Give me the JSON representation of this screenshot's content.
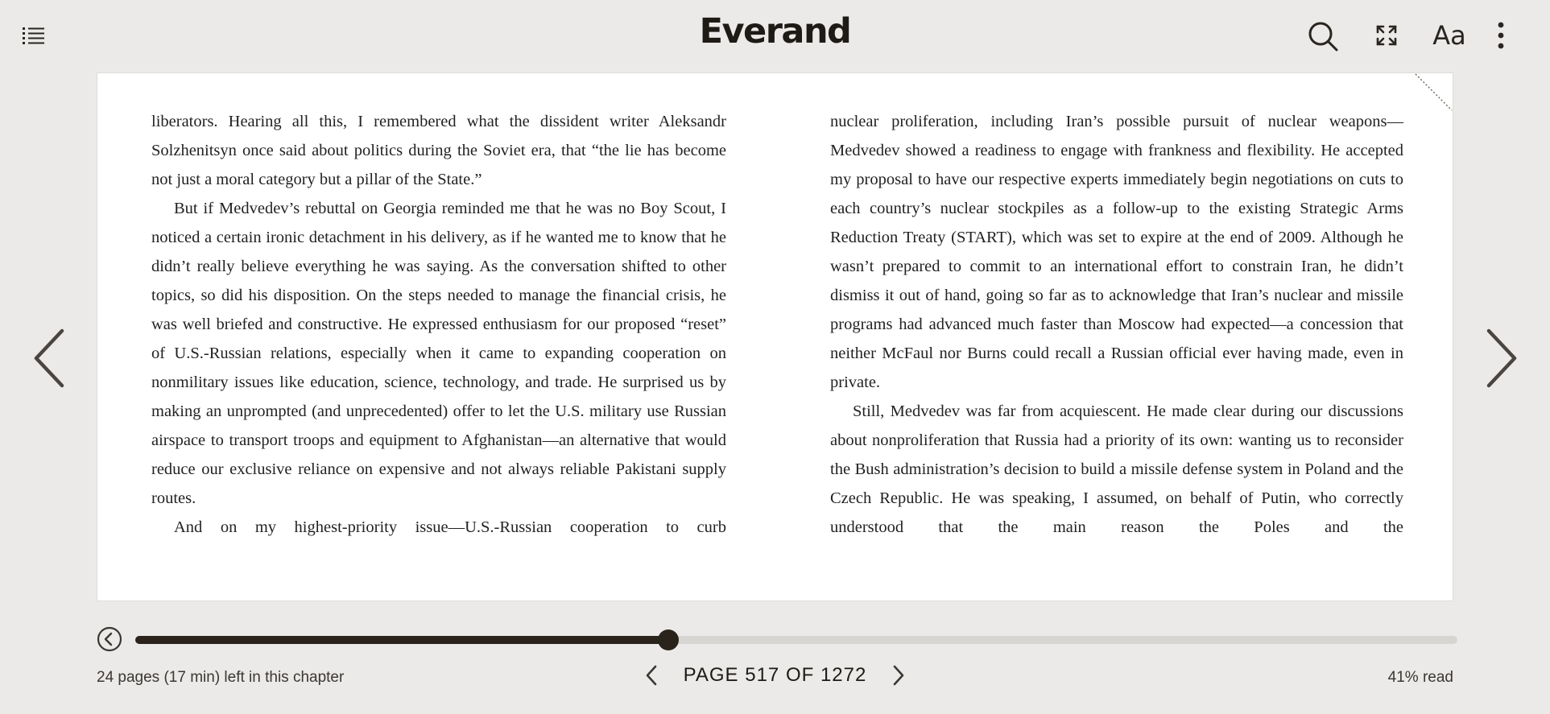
{
  "header": {
    "logo": "Everand",
    "toc_icon": "list-icon",
    "search_icon": "search-icon",
    "fullscreen_icon": "fullscreen-icon",
    "font_settings_label": "Aa",
    "more_icon": "more-vertical-icon"
  },
  "book": {
    "left_column": [
      "liberators. Hearing all this, I remembered what the dissident writer Aleksandr Solzhenitsyn once said about politics during the Soviet era, that “the lie has be­come not just a moral category but a pillar of the State.”",
      "But if Medvedev’s rebuttal on Georgia reminded me that he was no Boy Scout, I noticed a certain ironic detachment in his delivery, as if he wanted me to know that he didn’t really believe everything he was saying. As the conver­sation shifted to other topics, so did his disposition. On the steps needed to manage the financial crisis, he was well briefed and constructive. He expressed enthusiasm for our proposed “reset” of U.S.-Russian relations, especially when it came to expanding cooperation on nonmilitary issues like education, science, technology, and trade. He surprised us by making an unprompted (and un­precedented) offer to let the U.S. military use Russian airspace to transport troops and equipment to Afghanistan—an alternative that would reduce our exclusive reliance on expensive and not always reliable Pakistani supply routes.",
      "And on my highest-priority issue—U.S.-Russian cooperation to curb"
    ],
    "right_column": [
      "nuclear proliferation, including Iran’s possible pursuit of nuclear weapons—Medvedev showed a readiness to engage with frankness and flexibility. He ac­cepted my proposal to have our respective experts immediately begin negoti­ations on cuts to each country’s nuclear stockpiles as a follow-up to the exist­ing Strategic Arms Reduction Treaty (START), which was set to expire at the end of 2009. Although he wasn’t prepared to commit to an international effort to constrain Iran, he didn’t dismiss it out of hand, going so far as to acknowl­edge that Iran’s nuclear and missile programs had advanced much faster than Moscow had expected—a concession that neither McFaul nor Burns could re­call a Russian official ever having made, even in private.",
      "Still, Medvedev was far from acquiescent. He made clear during our discus­sions about nonproliferation that Russia had a priority of its own: wanting us to reconsider the Bush administration’s decision to build a missile defense sys­tem in Poland and the Czech Republic. He was speaking, I assumed, on behalf of Putin, who correctly understood that the main reason the Poles and the"
    ]
  },
  "navigation": {
    "prev_page_icon": "chevron-left-icon",
    "next_page_icon": "chevron-right-icon"
  },
  "progress": {
    "back_icon": "back-circle-icon",
    "fraction": 0.403
  },
  "footer": {
    "chapter_remaining": "24 pages (17 min) left in this chapter",
    "page_label": "PAGE 517 OF 1272",
    "percent_read": "41% read"
  }
}
